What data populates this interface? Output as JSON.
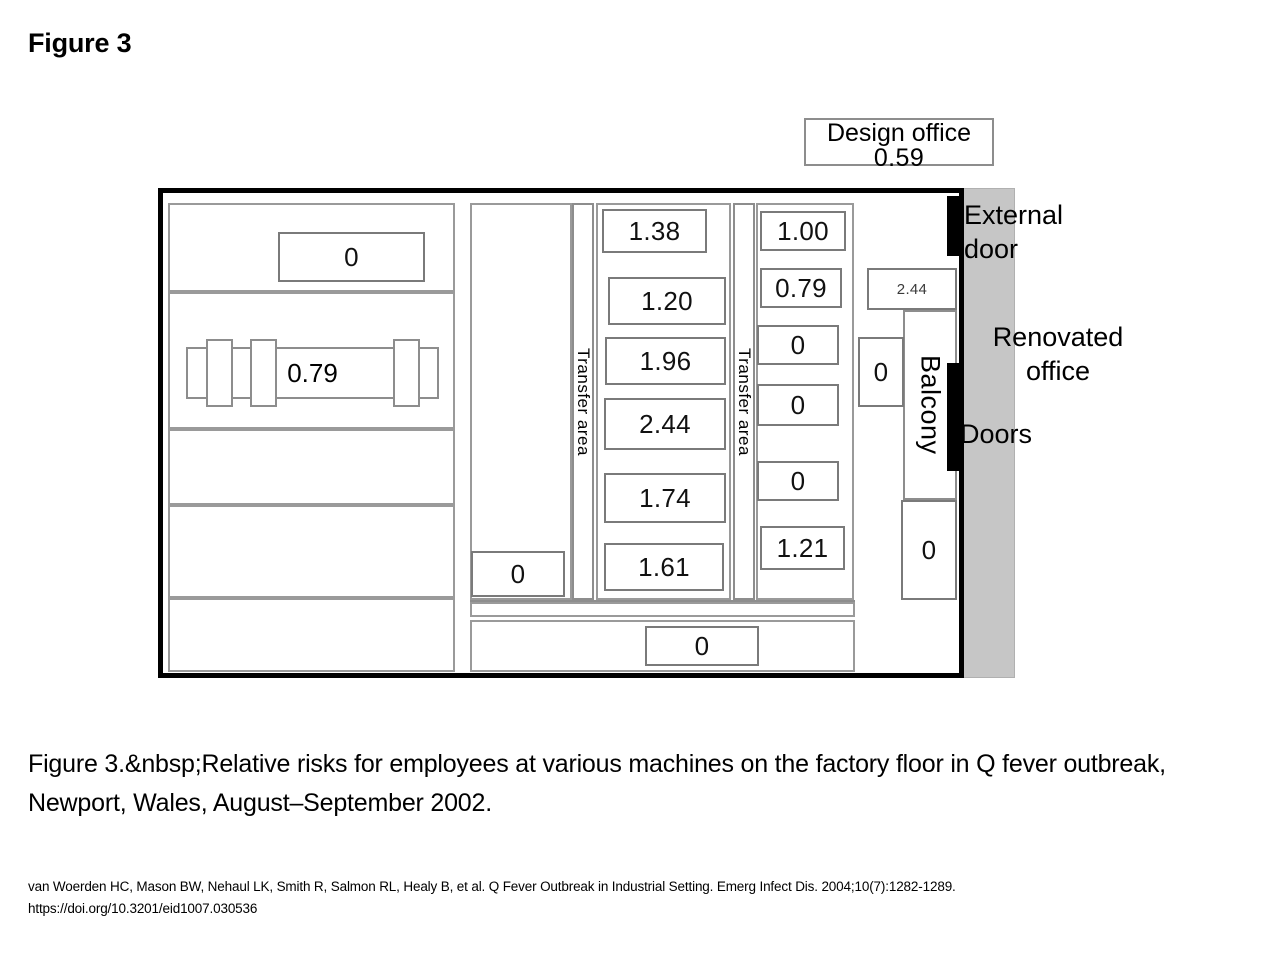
{
  "page": {
    "title": "Figure 3",
    "caption": "Figure 3.&nbsp;Relative risks for employees at various machines on the factory floor in Q fever outbreak, Newport, Wales, August–September 2002.",
    "citation_line1": "van Woerden HC, Mason BW, Nehaul LK, Smith R, Salmon RL, Healy B, et al. Q Fever Outbreak in Industrial Setting. Emerg Infect Dis. 2004;10(7):1282-1289.",
    "citation_line2": "https://doi.org/10.3201/eid1007.030536"
  },
  "colors": {
    "wall": "#000000",
    "renovated_office_fill": "#c6c6c6",
    "box_border": "#7a7a7a",
    "background": "#ffffff"
  },
  "chart_data": {
    "type": "diagram",
    "title": "Relative risks for employees at various machines on the factory floor",
    "value_label": "Relative risk",
    "locations": [
      {
        "name": "design-office",
        "label": "Design office",
        "value": "0.59"
      },
      {
        "name": "left-room-machine",
        "value": "0"
      },
      {
        "name": "left-long-machine",
        "value": "0.79"
      },
      {
        "name": "center-left-lower-machine",
        "value": "0"
      },
      {
        "name": "center-machine-1",
        "value": "1.38"
      },
      {
        "name": "center-machine-2",
        "value": "1.20"
      },
      {
        "name": "center-machine-3",
        "value": "1.96"
      },
      {
        "name": "center-machine-4",
        "value": "2.44"
      },
      {
        "name": "center-machine-5",
        "value": "1.74"
      },
      {
        "name": "center-machine-6",
        "value": "1.61"
      },
      {
        "name": "right-machine-1",
        "value": "1.00"
      },
      {
        "name": "right-machine-2",
        "value": "0.79"
      },
      {
        "name": "right-machine-3",
        "value": "0"
      },
      {
        "name": "right-machine-4",
        "value": "0"
      },
      {
        "name": "right-machine-5",
        "value": "0"
      },
      {
        "name": "right-machine-6",
        "value": "1.21"
      },
      {
        "name": "balcony-upper-machine",
        "value": "2.44"
      },
      {
        "name": "balcony-side-machine",
        "value": "0"
      },
      {
        "name": "balcony-lower-machine",
        "value": "0"
      },
      {
        "name": "bottom-machine",
        "value": "0"
      }
    ],
    "areas": [
      {
        "name": "transfer-area-left",
        "label": "Transfer area"
      },
      {
        "name": "transfer-area-right",
        "label": "Transfer area"
      },
      {
        "name": "balcony",
        "label": "Balcony"
      },
      {
        "name": "renovated-office",
        "label": "Renovated\noffice"
      }
    ],
    "annotations": [
      {
        "name": "external-door",
        "label": "External\ndoor"
      },
      {
        "name": "doors",
        "label": "Doors"
      }
    ]
  },
  "floorplan": {
    "design_office": {
      "label": "Design office",
      "value": "0.59"
    },
    "left_section": {
      "top_machine_value": "0",
      "long_machine_value": "0.79"
    },
    "center_left": {
      "lower_machine_value": "0"
    },
    "transfer_area_left_label": "Transfer area",
    "transfer_area_right_label": "Transfer area",
    "center_column_values": [
      "1.38",
      "1.20",
      "1.96",
      "2.44",
      "1.74",
      "1.61"
    ],
    "right_column_values": [
      "1.00",
      "0.79",
      "0",
      "0",
      "0",
      "1.21"
    ],
    "balcony": {
      "label": "Balcony",
      "upper_value": "2.44",
      "side_value": "0",
      "lower_value": "0"
    },
    "bottom_machine_value": "0",
    "annotations": {
      "external_door": "External\ndoor",
      "renovated_office": "Renovated\noffice",
      "doors": "Doors"
    }
  }
}
